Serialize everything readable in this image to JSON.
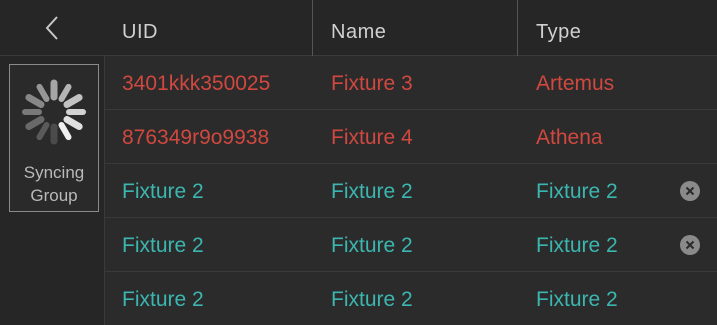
{
  "nav": {
    "back_icon": "chevron-left-icon"
  },
  "sync": {
    "icon": "spinner-icon",
    "label_line1": "Syncing",
    "label_line2": "Group"
  },
  "table": {
    "headers": [
      "UID",
      "Name",
      "Type"
    ],
    "rows": [
      {
        "uid": "3401kkk350025",
        "name": "Fixture 3",
        "type": "Artemus",
        "status": "red",
        "removable": false
      },
      {
        "uid": "876349r9o9938",
        "name": "Fixture 4",
        "type": "Athena",
        "status": "red",
        "removable": false
      },
      {
        "uid": "Fixture 2",
        "name": "Fixture 2",
        "type": "Fixture 2",
        "status": "teal",
        "removable": true
      },
      {
        "uid": "Fixture 2",
        "name": "Fixture 2",
        "type": "Fixture 2",
        "status": "teal",
        "removable": true
      },
      {
        "uid": "Fixture 2",
        "name": "Fixture 2",
        "type": "Fixture 2",
        "status": "teal",
        "removable": false
      }
    ]
  },
  "colors": {
    "pending": "#d0483f",
    "synced": "#3bb6b0"
  }
}
